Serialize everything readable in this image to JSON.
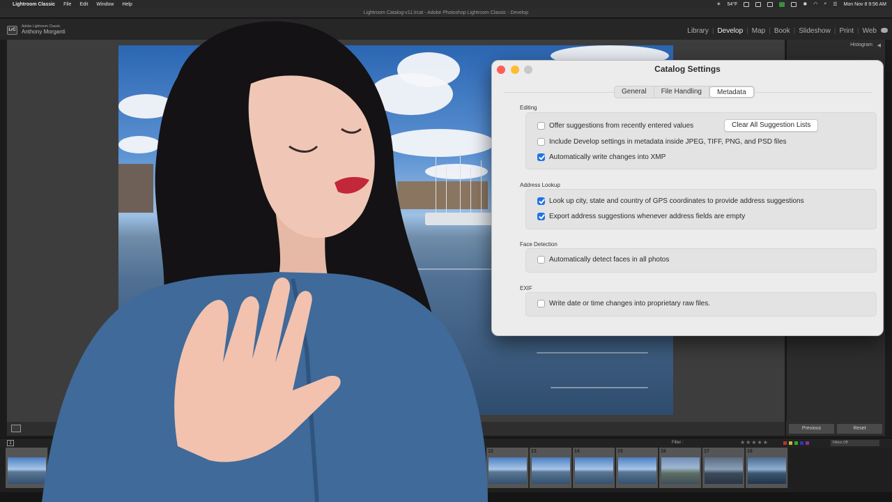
{
  "menubar": {
    "app_name": "Lightroom Classic",
    "menus": [
      "File",
      "Edit",
      "Window",
      "Help"
    ],
    "weather": "54°F",
    "datetime": "Mon Nov 8  9:56 AM"
  },
  "window": {
    "title": "Lightroom Catalog-v11.lrcat - Adobe Photoshop Lightroom Classic - Develop"
  },
  "identity": {
    "product": "Adobe Lightroom Classic",
    "user": "Anthony Morganti",
    "logo": "LrC"
  },
  "modules": {
    "items": [
      "Library",
      "Develop",
      "Map",
      "Book",
      "Slideshow",
      "Print",
      "Web"
    ],
    "active": "Develop"
  },
  "right_panel": {
    "histogram_label": "Histogram"
  },
  "buttons": {
    "previous": "Previous",
    "reset": "Reset"
  },
  "filmstrip": {
    "page_number": "1",
    "filter_label": "Filter :",
    "filters_value": "Filters Off",
    "frames": [
      "12",
      "13",
      "14",
      "15",
      "16",
      "17",
      "18"
    ]
  },
  "dialog": {
    "title": "Catalog Settings",
    "tabs": [
      "General",
      "File Handling",
      "Metadata"
    ],
    "active_tab": "Metadata",
    "sections": {
      "editing": {
        "label": "Editing",
        "offer_suggestions": {
          "label": "Offer suggestions from recently entered values",
          "checked": false
        },
        "clear_button": "Clear All Suggestion Lists",
        "include_develop": {
          "label": "Include Develop settings in metadata inside JPEG, TIFF, PNG, and PSD files",
          "checked": false
        },
        "auto_write_xmp": {
          "label": "Automatically write changes into XMP",
          "checked": true
        }
      },
      "address": {
        "label": "Address Lookup",
        "lookup_gps": {
          "label": "Look up city, state and country of GPS coordinates to provide address suggestions",
          "checked": true
        },
        "export_suggestions": {
          "label": "Export address suggestions whenever address fields are empty",
          "checked": true
        }
      },
      "face": {
        "label": "Face Detection",
        "auto_detect": {
          "label": "Automatically detect faces in all photos",
          "checked": false
        }
      },
      "exif": {
        "label": "EXIF",
        "write_date": {
          "label": "Write date or time changes into proprietary raw files.",
          "checked": false
        }
      }
    }
  },
  "colors": {
    "checkbox_on": "#1e73e8",
    "close": "#ff5f57",
    "minimize": "#febc2e",
    "zoom_disabled": "#c8c8c8"
  }
}
